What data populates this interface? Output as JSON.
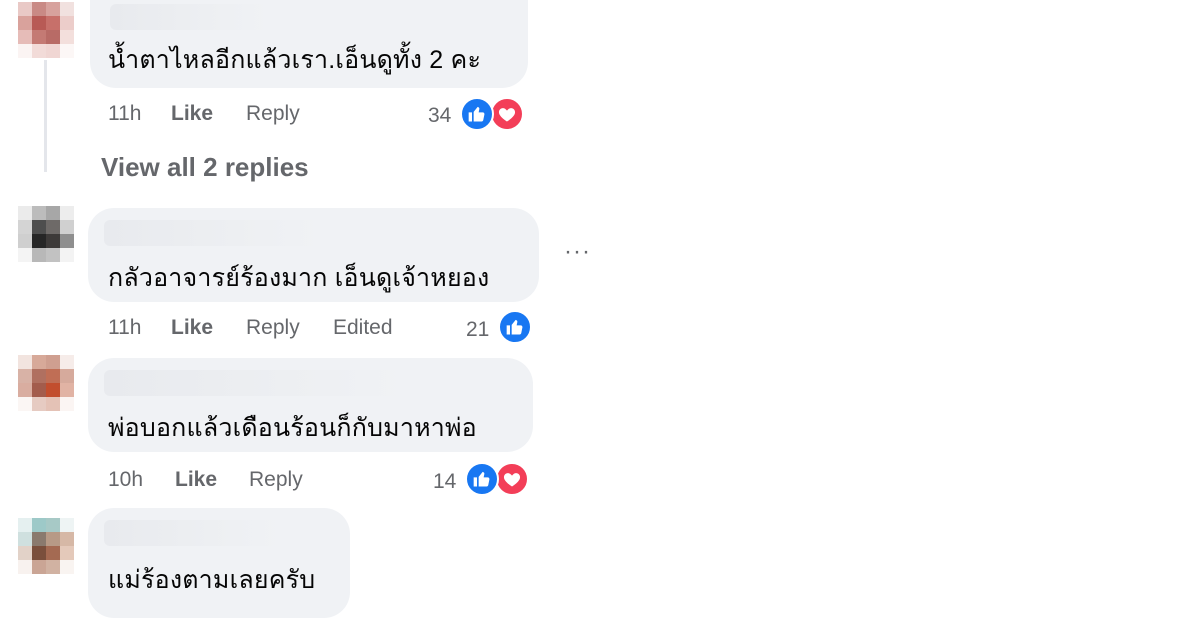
{
  "colors": {
    "bubble": "#f0f2f5",
    "meta_text": "#65676b",
    "like_blue": "#1877f2",
    "love_red": "#f33e58"
  },
  "comments": [
    {
      "text": "น้ำตาไหลอีกแล้วเรา.เอ็นดูทั้ง 2 คะ",
      "time": "11h",
      "like_label": "Like",
      "reply_label": "Reply",
      "reaction_count": "34",
      "reactions": [
        "like-icon",
        "love-icon"
      ]
    },
    {
      "text": "กลัวอาจารย์ร้องมาก เอ็นดูเจ้าหยอง",
      "time": "11h",
      "like_label": "Like",
      "reply_label": "Reply",
      "edited_label": "Edited",
      "reaction_count": "21",
      "reactions": [
        "like-icon"
      ]
    },
    {
      "text": "พ่อบอกแล้วเดือนร้อนก็กับมาหาพ่อ",
      "time": "10h",
      "like_label": "Like",
      "reply_label": "Reply",
      "reaction_count": "14",
      "reactions": [
        "like-icon",
        "love-icon"
      ]
    },
    {
      "text": "แม่ร้องตามเลยครับ"
    }
  ],
  "view_replies_label": "View all 2 replies",
  "more_options_label": "···"
}
